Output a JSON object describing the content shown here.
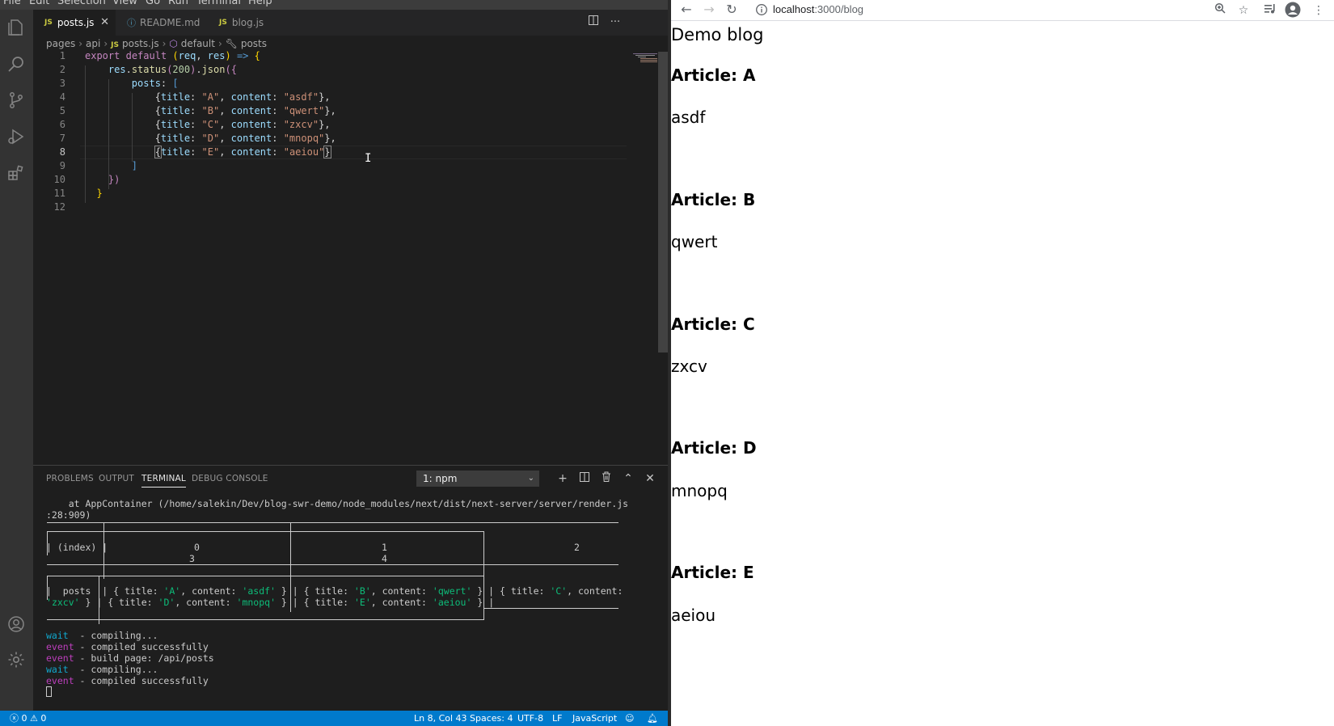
{
  "menubar": [
    "File",
    "Edit",
    "Selection",
    "View",
    "Go",
    "Run",
    "Terminal",
    "Help"
  ],
  "tabs": [
    {
      "badge": "JS",
      "label": "posts.js",
      "active": true
    },
    {
      "badge": "ⓘ",
      "label": "README.md",
      "active": false
    },
    {
      "badge": "JS",
      "label": "blog.js",
      "active": false
    }
  ],
  "breadcrumb": {
    "parts": [
      "pages",
      "api"
    ],
    "file_badge": "JS",
    "file": "posts.js",
    "symbol1": "default",
    "symbol2": "posts"
  },
  "editor": {
    "line_numbers": [
      "1",
      "2",
      "3",
      "4",
      "5",
      "6",
      "7",
      "8",
      "9",
      "10",
      "11",
      "12"
    ],
    "current_line": 8,
    "posts": [
      {
        "title": "A",
        "content": "asdf"
      },
      {
        "title": "B",
        "content": "qwert"
      },
      {
        "title": "C",
        "content": "zxcv"
      },
      {
        "title": "D",
        "content": "mnopq"
      },
      {
        "title": "E",
        "content": "aeiou"
      }
    ]
  },
  "panel": {
    "tabs": [
      "PROBLEMS",
      "OUTPUT",
      "TERMINAL",
      "DEBUG CONSOLE"
    ],
    "active_tab": "TERMINAL",
    "terminal_select": "1: npm"
  },
  "terminal": {
    "stack_line1": "    at AppContainer (/home/salekin/Dev/blog-swr-demo/node_modules/next/dist/next-server/server/render.js",
    "stack_line2": ":28:909)",
    "table_index_label": "(index)",
    "col0": "0",
    "col0b": "3",
    "col1": "1",
    "col1b": "4",
    "col2": "2",
    "row_label": "posts",
    "logs": [
      {
        "tag": "wait",
        "text": "  - compiling..."
      },
      {
        "tag": "event",
        "text": " - compiled successfully"
      },
      {
        "tag": "event",
        "text": " - build page: /api/posts"
      },
      {
        "tag": "wait",
        "text": "  - compiling..."
      },
      {
        "tag": "event",
        "text": " - compiled successfully"
      }
    ]
  },
  "statusbar": {
    "errors": "0",
    "warnings": "0",
    "position": "Ln 8, Col 43",
    "spaces": "Spaces: 4",
    "encoding": "UTF-8",
    "eol": "LF",
    "language": "JavaScript"
  },
  "browser": {
    "url_host": "localhost",
    "url_path": ":3000/blog",
    "page_title": "Demo blog",
    "article_prefix": "Article: ",
    "articles": [
      {
        "title": "A",
        "content": "asdf"
      },
      {
        "title": "B",
        "content": "qwert"
      },
      {
        "title": "C",
        "content": "zxcv"
      },
      {
        "title": "D",
        "content": "mnopq"
      },
      {
        "title": "E",
        "content": "aeiou"
      }
    ]
  },
  "colors": {
    "statusbar": "#007acc",
    "editor_bg": "#1e1e1e",
    "string": "#ce9178",
    "keyword": "#c586c0"
  }
}
